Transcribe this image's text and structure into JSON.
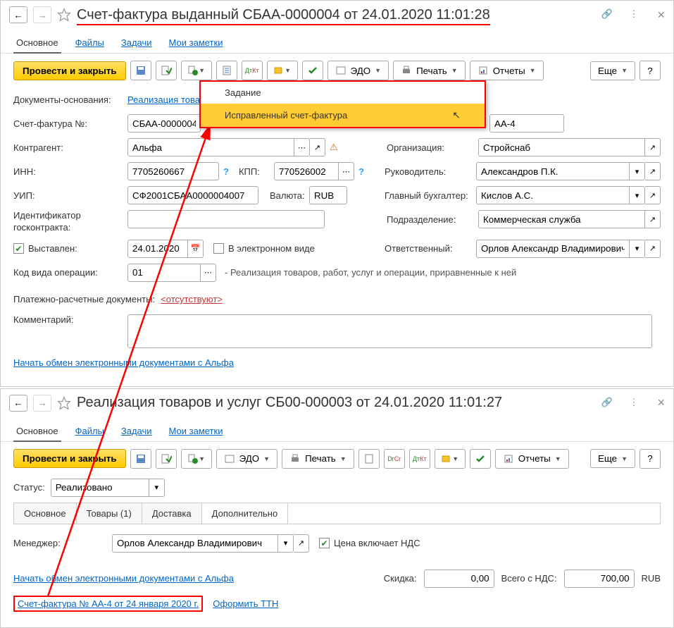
{
  "window1": {
    "title": "Счет-фактура выданный СБАА-0000004 от 24.01.2020 11:01:28",
    "tabs": {
      "main": "Основное",
      "files": "Файлы",
      "tasks": "Задачи",
      "notes": "Мои заметки"
    },
    "toolbar": {
      "post_close": "Провести и закрыть",
      "edo": "ЭДО",
      "print": "Печать",
      "reports": "Отчеты",
      "more": "Еще",
      "help": "?"
    },
    "dropdown": {
      "task": "Задание",
      "corrected": "Исправленный счет-фактура"
    },
    "labels": {
      "basis": "Документы-основания:",
      "basis_link": "Реализация товар",
      "invoice_no": "Счет-фактура №:",
      "counterparty": "Контрагент:",
      "inn": "ИНН:",
      "kpp": "КПП:",
      "uip": "УИП:",
      "currency": "Валюта:",
      "contract_id": "Идентификатор госконтракта:",
      "issued": "Выставлен:",
      "electronic": "В электронном виде",
      "op_code": "Код вида операции:",
      "op_desc": "- Реализация товаров, работ, услуг и операции, приравненные к ней",
      "payment_docs": "Платежно-расчетные документы:",
      "payment_absent": "<отсутствуют>",
      "comment": "Комментарий:",
      "exchange_link": "Начать обмен электронными документами с Альфа",
      "org": "Организация:",
      "head": "Руководитель:",
      "accountant": "Главный бухгалтер:",
      "dept": "Подразделение:",
      "responsible": "Ответственный:",
      "alt_no": "АА-4"
    },
    "values": {
      "invoice_no": "СБАА-0000004",
      "counterparty": "Альфа",
      "inn": "7705260667",
      "kpp": "770526002",
      "uip": "СФ2001СБАА0000004007",
      "currency": "RUB",
      "issued_date": "24.01.2020",
      "op_code": "01",
      "org": "Стройснаб",
      "head": "Александров П.К.",
      "accountant": "Кислов А.С.",
      "dept": "Коммерческая служба",
      "responsible": "Орлов Александр Владимирович"
    }
  },
  "window2": {
    "title": "Реализация товаров и услуг СБ00-000003 от 24.01.2020 11:01:27",
    "tabs": {
      "main": "Основное",
      "files": "Файлы",
      "tasks": "Задачи",
      "notes": "Мои заметки"
    },
    "toolbar": {
      "post_close": "Провести и закрыть",
      "edo": "ЭДО",
      "print": "Печать",
      "reports": "Отчеты",
      "more": "Еще",
      "help": "?"
    },
    "status_label": "Статус:",
    "status_value": "Реализовано",
    "panes": {
      "main": "Основное",
      "goods": "Товары (1)",
      "delivery": "Доставка",
      "extra": "Дополнительно"
    },
    "labels": {
      "manager": "Менеджер:",
      "price_vat": "Цена включает НДС",
      "exchange_link": "Начать обмен электронными документами с Альфа",
      "invoice_link": "Счет-фактура № АА-4 от 24 января 2020 г.",
      "ttn_link": "Оформить ТТН",
      "discount": "Скидка:",
      "total_vat": "Всего с НДС:",
      "currency": "RUB"
    },
    "values": {
      "manager": "Орлов Александр Владимирович",
      "discount": "0,00",
      "total": "700,00"
    }
  }
}
